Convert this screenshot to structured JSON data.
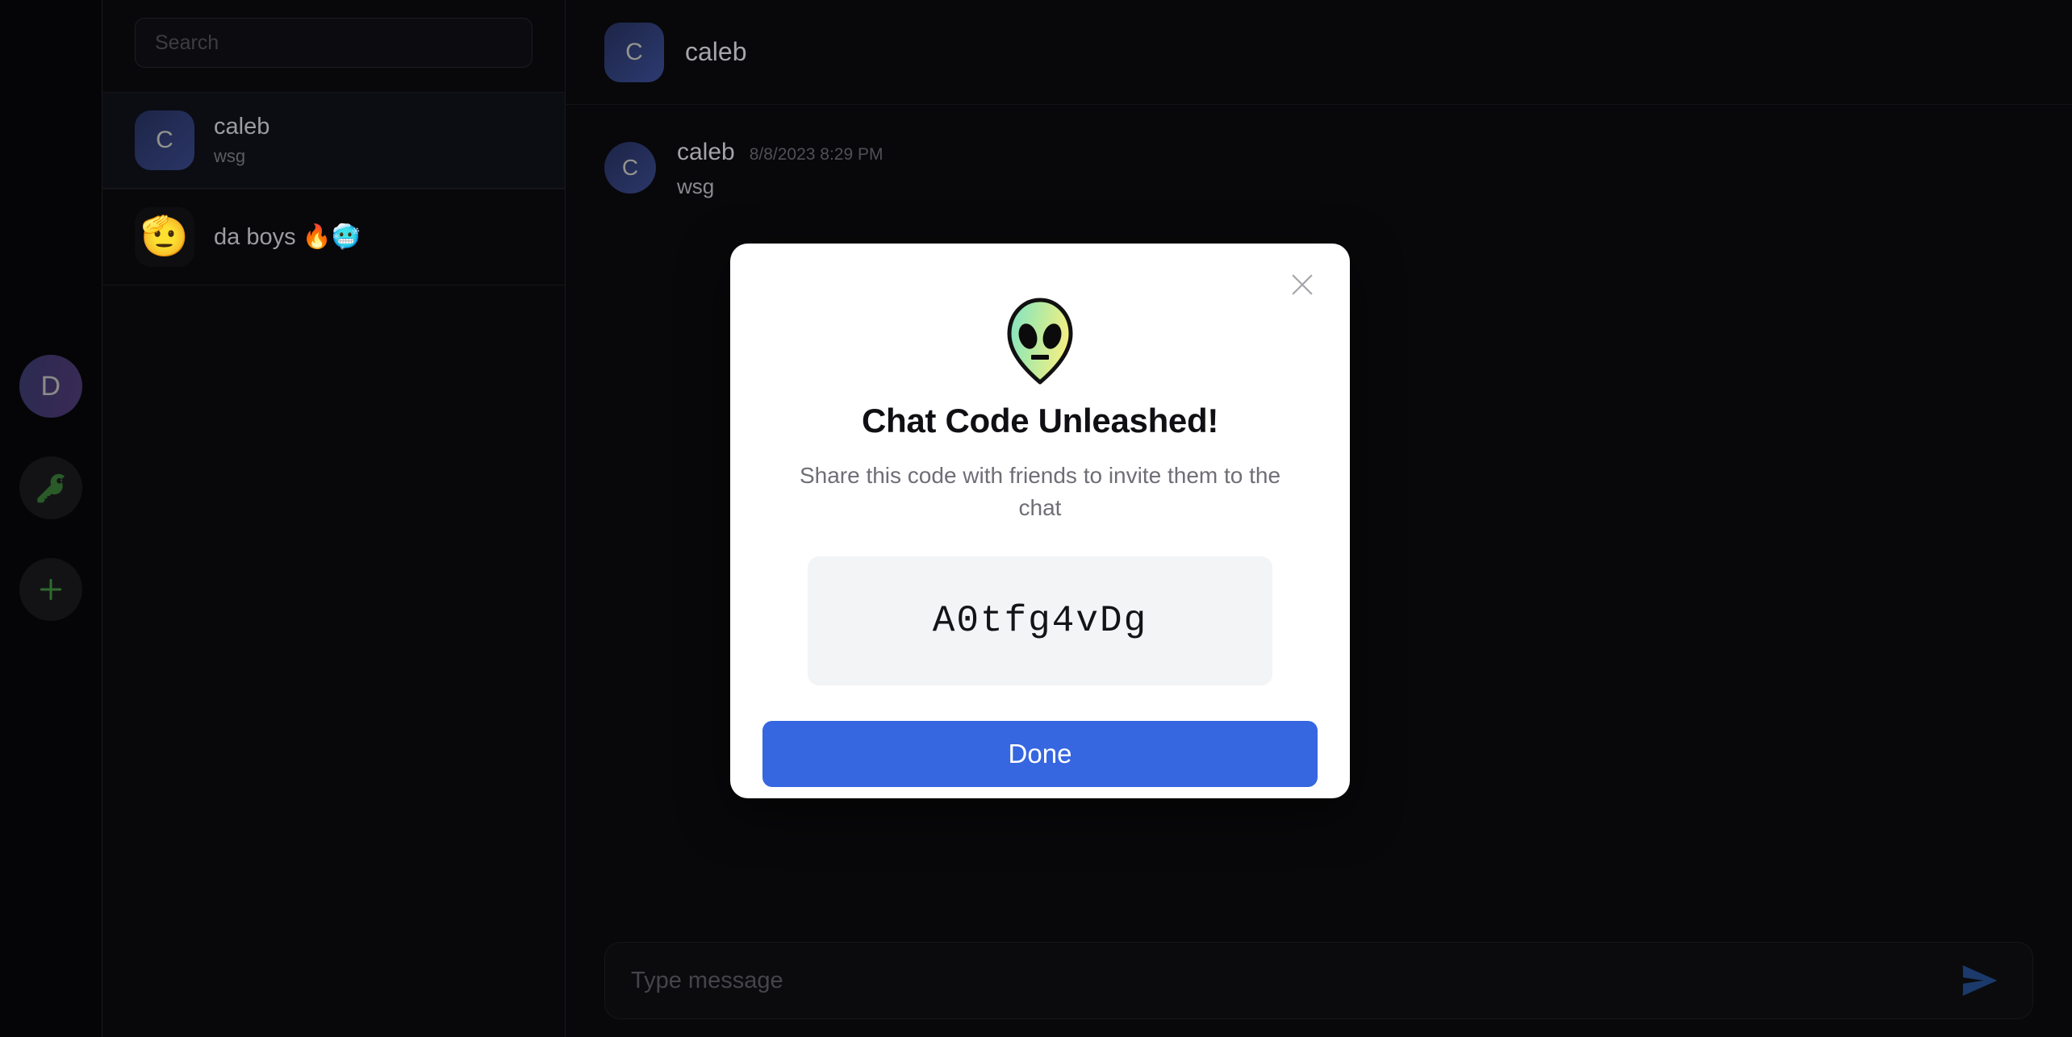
{
  "rail": {
    "user_avatar_initial": "D",
    "items": [
      {
        "name": "user-avatar",
        "label": "D",
        "icon": "user-avatar"
      },
      {
        "name": "join-chat",
        "label": "",
        "icon": "key-icon"
      },
      {
        "name": "new-chat",
        "label": "",
        "icon": "plus-icon"
      }
    ]
  },
  "search": {
    "value": "",
    "placeholder": "Search"
  },
  "chat_list": [
    {
      "avatar_type": "initial",
      "avatar": "C",
      "title": "caleb",
      "subtitle": "wsg",
      "active": true
    },
    {
      "avatar_type": "emoji",
      "avatar": "🫡",
      "title": "da boys 🔥🥶",
      "subtitle": "",
      "active": false
    }
  ],
  "chat_header": {
    "avatar": "C",
    "title": "caleb"
  },
  "messages": [
    {
      "avatar": "C",
      "author": "caleb",
      "timestamp": "8/8/2023 8:29 PM",
      "text": "wsg"
    }
  ],
  "composer": {
    "value": "",
    "placeholder": "Type message",
    "send_icon": "send-icon"
  },
  "modal": {
    "close_icon": "close-icon",
    "emoji_icon": "alien-icon",
    "title": "Chat Code Unleashed!",
    "subtitle": "Share this code with friends to invite them to the chat",
    "code": "A0tfg4vDg",
    "primary_button": "Done"
  },
  "colors": {
    "app_background": "#050507",
    "panel_background": "#08080b",
    "accent_blue": "#3666e0",
    "send_blue": "#16305c",
    "key_green": "#2a5a28",
    "code_box": "#f3f4f6",
    "modal_background": "#ffffff"
  }
}
